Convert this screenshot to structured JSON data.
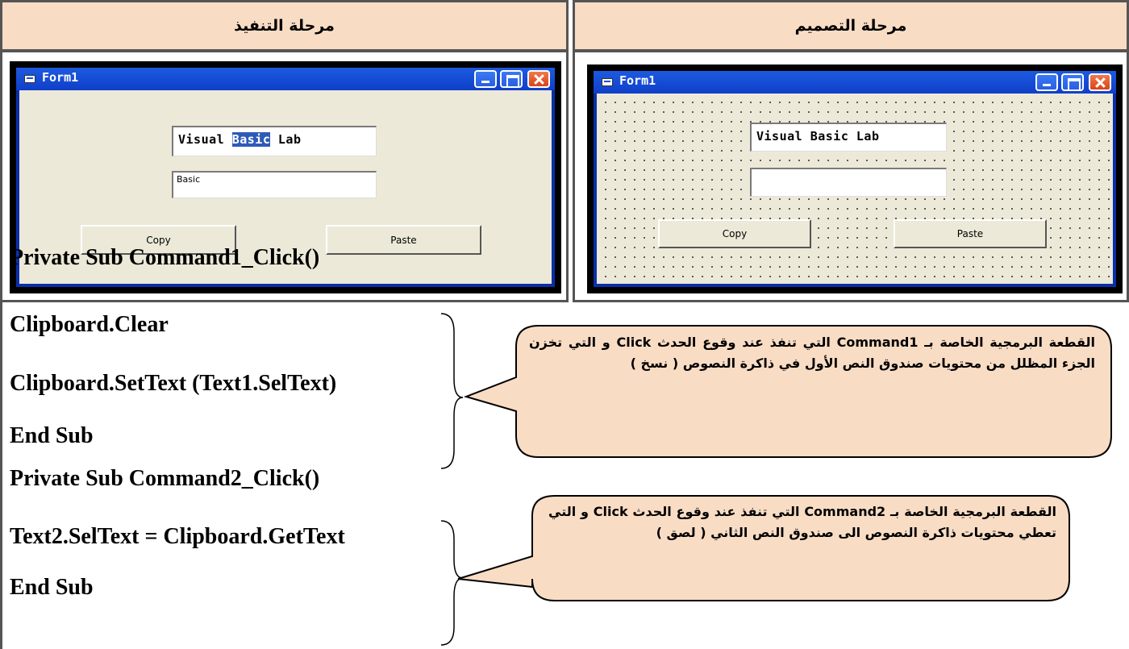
{
  "headers": {
    "execution": "مرحلة التنفيذ",
    "design": "مرحلة التصميم"
  },
  "run_form": {
    "title": "Form1",
    "text1_before": "Visual ",
    "text1_selected": "Basic",
    "text1_after": " Lab",
    "text2": "Basic",
    "copy_label": "Copy",
    "paste_label": "Paste"
  },
  "design_form": {
    "title": "Form1",
    "text1": "Visual Basic Lab",
    "text2": "",
    "copy_label": "Copy",
    "paste_label": "Paste"
  },
  "code": {
    "line1": "Private Sub Command1_Click()",
    "line2": "Clipboard.Clear",
    "line3": "Clipboard.SetText (Text1.SelText)",
    "line4": "End Sub",
    "line5": "Private Sub Command2_Click()",
    "line6": "Text2.SelText = Clipboard.GetText",
    "line7": "End Sub"
  },
  "callouts": {
    "first": "القطعة البرمجية الخاصة بـ Command1 التي تنفذ عند وقوع الحدث Click و التي تخزن الجزء المظلل من محتويات صندوق النص الأول في ذاكرة النصوص ( نسخ )",
    "second": "القطعة البرمجية الخاصة بـ Command2 التي تنفذ عند وقوع الحدث Click و التي تعطي محتويات ذاكرة النصوص الى صندوق النص الثاني ( لصق )"
  },
  "colors": {
    "header_bg": "#f9dcc4",
    "callout_bg": "#f9dcc4",
    "window_blue": "#0a2fa8",
    "selection": "#2e5ab8"
  }
}
